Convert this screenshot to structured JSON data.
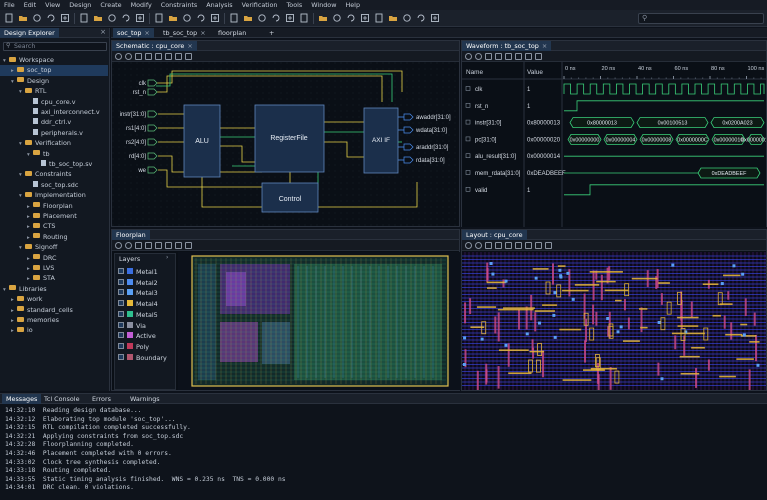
{
  "menu": [
    "File",
    "Edit",
    "View",
    "Design",
    "Create",
    "Modify",
    "Constraints",
    "Analysis",
    "Verification",
    "Tools",
    "Window",
    "Help"
  ],
  "search": {
    "placeholder": "Search"
  },
  "tabs": {
    "main": [
      "soc_top",
      "tb_soc_top",
      "floorplan"
    ],
    "add": "+"
  },
  "explorer": {
    "title": "Design Explorer",
    "search": "Search",
    "items": [
      {
        "label": "Workspace",
        "kind": "folder",
        "open": true,
        "indent": 0
      },
      {
        "label": "soc_top",
        "kind": "folder",
        "indent": 1,
        "selected": true
      },
      {
        "label": "Design",
        "kind": "folder",
        "open": true,
        "indent": 1
      },
      {
        "label": "RTL",
        "kind": "folder",
        "open": true,
        "indent": 2
      },
      {
        "label": "cpu_core.v",
        "kind": "file",
        "indent": 3
      },
      {
        "label": "axi_interconnect.v",
        "kind": "file",
        "indent": 3
      },
      {
        "label": "ddr_ctrl.v",
        "kind": "file",
        "indent": 3
      },
      {
        "label": "peripherals.v",
        "kind": "file",
        "indent": 3
      },
      {
        "label": "Verification",
        "kind": "folder",
        "open": true,
        "indent": 2
      },
      {
        "label": "tb",
        "kind": "folder",
        "open": true,
        "indent": 3
      },
      {
        "label": "tb_soc_top.sv",
        "kind": "file",
        "indent": 4
      },
      {
        "label": "Constraints",
        "kind": "folder",
        "open": true,
        "indent": 2
      },
      {
        "label": "soc_top.sdc",
        "kind": "file",
        "indent": 3
      },
      {
        "label": "Implementation",
        "kind": "folder",
        "open": true,
        "indent": 2
      },
      {
        "label": "Floorplan",
        "kind": "folder",
        "indent": 3
      },
      {
        "label": "Placement",
        "kind": "folder",
        "indent": 3
      },
      {
        "label": "CTS",
        "kind": "folder",
        "indent": 3
      },
      {
        "label": "Routing",
        "kind": "folder",
        "indent": 3
      },
      {
        "label": "Signoff",
        "kind": "folder",
        "open": true,
        "indent": 2
      },
      {
        "label": "DRC",
        "kind": "folder",
        "indent": 3
      },
      {
        "label": "LVS",
        "kind": "folder",
        "indent": 3
      },
      {
        "label": "STA",
        "kind": "folder",
        "indent": 3
      },
      {
        "label": "Libraries",
        "kind": "folder",
        "open": true,
        "indent": 0
      },
      {
        "label": "work",
        "kind": "folder",
        "indent": 1
      },
      {
        "label": "standard_cells",
        "kind": "folder",
        "indent": 1
      },
      {
        "label": "memories",
        "kind": "folder",
        "indent": 1
      },
      {
        "label": "io",
        "kind": "folder",
        "indent": 1
      }
    ]
  },
  "schematic": {
    "title": "Schematic : cpu_core",
    "inputs": [
      "clk",
      "rst_n",
      "instr[31:0]",
      "rs1[4:0]",
      "rs2[4:0]",
      "rd[4:0]",
      "we"
    ],
    "outputs": [
      "awaddr[31:0]",
      "wdata[31:0]",
      "araddr[31:0]",
      "rdata[31:0]"
    ],
    "blocks": {
      "alu": "ALU",
      "regfile": "RegisterFile",
      "axi": "AXI IF",
      "control": "Control"
    }
  },
  "waveform": {
    "title": "Waveform : tb_soc_top",
    "col_name": "Name",
    "col_value": "Value",
    "time_labels": [
      "0 ns",
      "20 ns",
      "40 ns",
      "60 ns",
      "80 ns",
      "100 ns"
    ],
    "signals": [
      {
        "name": "clk",
        "value": "1"
      },
      {
        "name": "rst_n",
        "value": "1"
      },
      {
        "name": "instr[31:0]",
        "value": "0x80000013",
        "segments": [
          "0x80000013",
          "0x00100513",
          "0x0200A023"
        ]
      },
      {
        "name": "pc[31:0]",
        "value": "0x00000020",
        "segments": [
          "0x00000000",
          "0x00000004",
          "0x00000008",
          "0x0000000C",
          "0x00000010",
          "0x00000014"
        ]
      },
      {
        "name": "alu_result[31:0]",
        "value": "0x00000014"
      },
      {
        "name": "mem_rdata[31:0]",
        "value": "0xDEADBEEF",
        "segments": [
          "0xDEADBEEF"
        ]
      },
      {
        "name": "valid",
        "value": "1"
      }
    ]
  },
  "floorplan": {
    "title": "Floorplan",
    "layers_title": "Layers",
    "layers": [
      {
        "name": "Metal1",
        "color": "#3b6fe0"
      },
      {
        "name": "Metal2",
        "color": "#4d8cf0"
      },
      {
        "name": "Metal3",
        "color": "#5aa0f5"
      },
      {
        "name": "Metal4",
        "color": "#e6b93a"
      },
      {
        "name": "Metal5",
        "color": "#2fbf8f"
      },
      {
        "name": "Via",
        "color": "#8a8fa0"
      },
      {
        "name": "Active",
        "color": "#c25fd6"
      },
      {
        "name": "Poly",
        "color": "#c0395a"
      },
      {
        "name": "Boundary",
        "color": "#b0566e"
      }
    ]
  },
  "layout": {
    "title": "Layout : cpu_core"
  },
  "console": {
    "tabs": [
      "Messages",
      "Tcl Console",
      "Errors",
      "Warnings"
    ],
    "lines": [
      "14:32:10  Reading design database...",
      "14:32:12  Elaborating top module 'soc_top'...",
      "14:32:15  RTL compilation completed successfully.",
      "14:32:21  Applying constraints from soc_top.sdc",
      "14:32:28  Floorplanning completed.",
      "14:32:46  Placement completed with 0 errors.",
      "14:33:02  Clock tree synthesis completed.",
      "14:33:18  Routing completed.",
      "14:33:55  Static timing analysis finished.  WNS = 0.235 ns  TNS = 0.000 ns",
      "14:34:01  DRC clean. 0 violations."
    ]
  }
}
